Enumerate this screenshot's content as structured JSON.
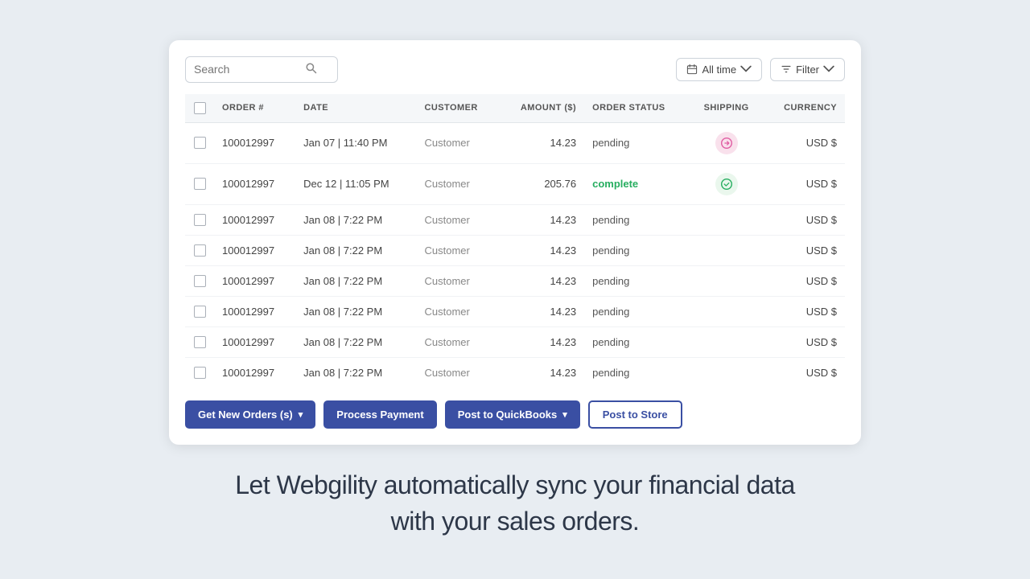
{
  "toolbar": {
    "search_placeholder": "Search",
    "time_filter_label": "All time",
    "filter_label": "Filter"
  },
  "table": {
    "headers": [
      {
        "id": "checkbox",
        "label": ""
      },
      {
        "id": "order_num",
        "label": "ORDER #"
      },
      {
        "id": "date",
        "label": "DATE"
      },
      {
        "id": "customer",
        "label": "CUSTOMER"
      },
      {
        "id": "amount",
        "label": "AMOUNT ($)"
      },
      {
        "id": "order_status",
        "label": "ORDER STATUS"
      },
      {
        "id": "shipping",
        "label": "SHIPPING"
      },
      {
        "id": "currency",
        "label": "CURRENCY"
      }
    ],
    "rows": [
      {
        "order": "100012997",
        "date": "Jan 07 | 11:40 PM",
        "customer": "Customer",
        "amount": "14.23",
        "status": "pending",
        "shipping": "arrow",
        "currency": "USD $"
      },
      {
        "order": "100012997",
        "date": "Dec 12 | 11:05 PM",
        "customer": "Customer",
        "amount": "205.76",
        "status": "complete",
        "shipping": "check",
        "currency": "USD $"
      },
      {
        "order": "100012997",
        "date": "Jan 08 | 7:22 PM",
        "customer": "Customer",
        "amount": "14.23",
        "status": "pending",
        "shipping": "",
        "currency": "USD $"
      },
      {
        "order": "100012997",
        "date": "Jan 08 | 7:22 PM",
        "customer": "Customer",
        "amount": "14.23",
        "status": "pending",
        "shipping": "",
        "currency": "USD $"
      },
      {
        "order": "100012997",
        "date": "Jan 08 | 7:22 PM",
        "customer": "Customer",
        "amount": "14.23",
        "status": "pending",
        "shipping": "",
        "currency": "USD $"
      },
      {
        "order": "100012997",
        "date": "Jan 08 | 7:22 PM",
        "customer": "Customer",
        "amount": "14.23",
        "status": "pending",
        "shipping": "",
        "currency": "USD $"
      },
      {
        "order": "100012997",
        "date": "Jan 08 | 7:22 PM",
        "customer": "Customer",
        "amount": "14.23",
        "status": "pending",
        "shipping": "",
        "currency": "USD $"
      },
      {
        "order": "100012997",
        "date": "Jan 08 | 7:22 PM",
        "customer": "Customer",
        "amount": "14.23",
        "status": "pending",
        "shipping": "",
        "currency": "USD $"
      }
    ]
  },
  "actions": {
    "get_new_orders": "Get New Orders (s)",
    "process_payment": "Process Payment",
    "post_quickbooks": "Post to QuickBooks",
    "post_store": "Post to Store"
  },
  "tagline": {
    "line1": "Let Webgility automatically sync your financial data",
    "line2": "with your sales orders."
  }
}
